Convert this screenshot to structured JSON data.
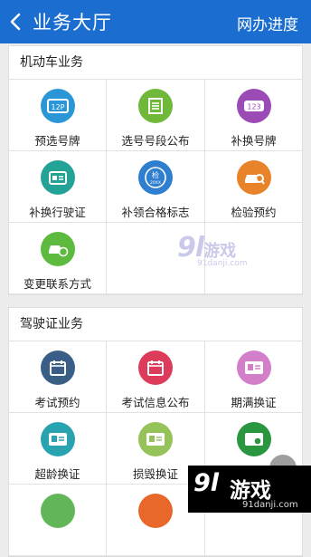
{
  "header": {
    "title": "业务大厅",
    "right_link": "网办进度"
  },
  "sections": [
    {
      "title": "机动车业务",
      "items": [
        {
          "label": "预选号牌",
          "icon": "license-plate-icon",
          "color": "#2a96d6"
        },
        {
          "label": "选号号段公布",
          "icon": "document-list-icon",
          "color": "#6fb83a"
        },
        {
          "label": "补换号牌",
          "icon": "plate-123-icon",
          "color": "#9b4bb5"
        },
        {
          "label": "补换行驶证",
          "icon": "vehicle-license-icon",
          "color": "#23a296"
        },
        {
          "label": "补领合格标志",
          "icon": "inspection-badge-icon",
          "color": "#2f7fd0"
        },
        {
          "label": "检验预约",
          "icon": "car-search-icon",
          "color": "#e8832a"
        },
        {
          "label": "变更联系方式",
          "icon": "car-phone-icon",
          "color": "#5cbb3e"
        }
      ]
    },
    {
      "title": "驾驶证业务",
      "items": [
        {
          "label": "考试预约",
          "icon": "calendar-icon",
          "color": "#395f86"
        },
        {
          "label": "考试信息公布",
          "icon": "calendar-icon",
          "color": "#dc3b5a"
        },
        {
          "label": "期满换证",
          "icon": "id-card-icon",
          "color": "#d37ec9"
        },
        {
          "label": "超龄换证",
          "icon": "id-card-icon",
          "color": "#2aa3b0"
        },
        {
          "label": "损毁换证",
          "icon": "id-card-icon",
          "color": "#96c25a"
        },
        {
          "label": "",
          "icon": "id-card-icon",
          "color": "#2a9640"
        }
      ]
    }
  ],
  "watermark": {
    "mid_logo": "9l",
    "mid_text": "游戏",
    "mid_url": "91danji.com",
    "bottom_logo": "9l",
    "bottom_text": "游戏",
    "bottom_url": "91danji.com"
  }
}
